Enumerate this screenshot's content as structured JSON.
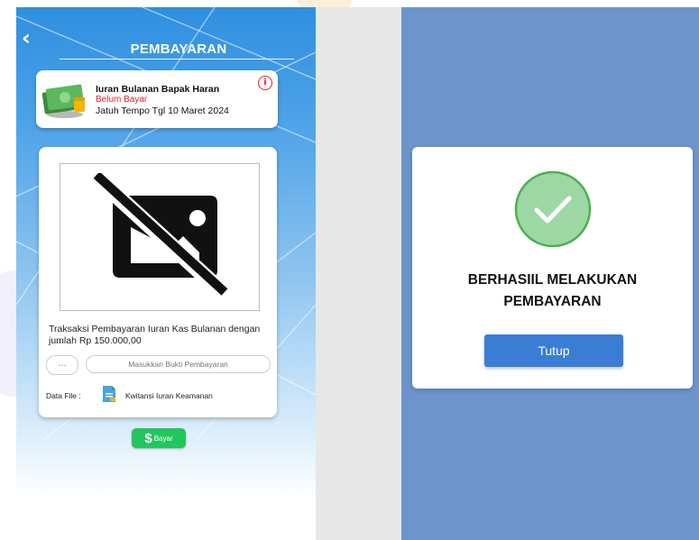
{
  "header": {
    "back_icon": "chevron-left-icon",
    "title": "PEMBAYARAN"
  },
  "bill": {
    "name": "Iuran Bulanan Bapak Haran",
    "status": "Belum Bayar",
    "due": "Jatuh Tempo Tgl 10 Maret 2024",
    "icon": "money-icon",
    "info_icon": "info-icon",
    "status_color": "#e8202b"
  },
  "upload": {
    "image_icon": "image-off-icon",
    "description": "Traksaksi Pembayaran Iuran Kas Bulanan dengan jumlah Rp 150.000,00",
    "dots_label": "...",
    "proof_placeholder": "Masukkan Bukti Pembayaran",
    "file_label": "Data File :",
    "file_icon": "document-icon",
    "file_name": "Kwitansi Iuran Keamanan"
  },
  "pay_button": {
    "symbol": "$",
    "label": "Bayar",
    "color": "#22c55e"
  },
  "modal": {
    "icon": "check-circle-icon",
    "message_line1": "BERHASIIL MELAKUKAN",
    "message_line2": "PEMBAYARAN",
    "close_label": "Tutup",
    "button_color": "#3a7dd4",
    "overlay_color": "#6d95cc"
  }
}
